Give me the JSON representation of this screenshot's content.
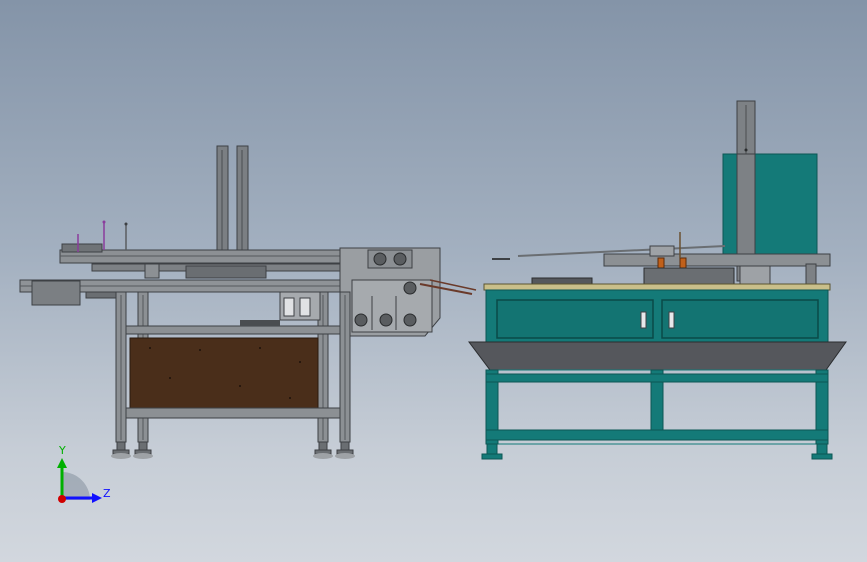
{
  "triad": {
    "y_label": "Y",
    "z_label": "Z",
    "y_color": "#00b000",
    "z_color": "#1010ff",
    "origin_color": "#d00000"
  },
  "colors": {
    "frame_gray": "#6f7377",
    "frame_dark": "#3d4044",
    "frame_light": "#a9adb1",
    "wood_panel": "#4a2e1a",
    "teal_cabinet": "#147a78",
    "teal_dark": "#0c5654",
    "tray_gray": "#55575c",
    "top_plate": "#c9bf8a",
    "orange_part": "#c0601a",
    "purple_rod": "#8a3c9c"
  },
  "views": {
    "left": "side-view-machine-frame",
    "right": "front-view-cabinet-machine"
  }
}
